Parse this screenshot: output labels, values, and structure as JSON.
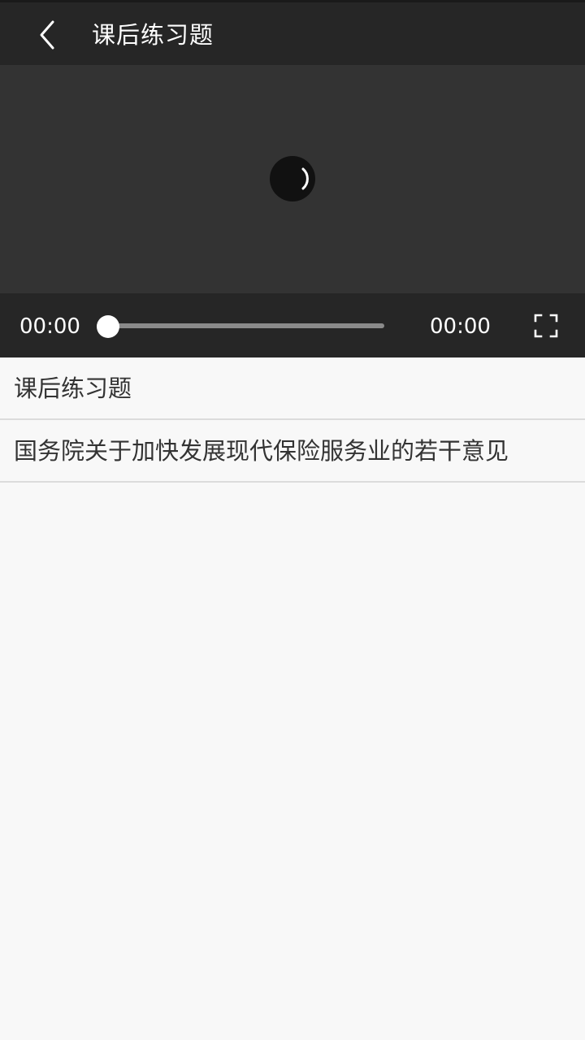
{
  "header": {
    "back_icon": "chevron-left-icon",
    "title": "课后练习题"
  },
  "player": {
    "loading_icon": "loading-spinner-icon",
    "current_time": "00:00",
    "total_time": "00:00",
    "progress": 0,
    "fullscreen_icon": "fullscreen-icon"
  },
  "list": {
    "items": [
      {
        "label": "课后练习题"
      },
      {
        "label": "国务院关于加快发展现代保险服务业的若干意见"
      }
    ]
  }
}
